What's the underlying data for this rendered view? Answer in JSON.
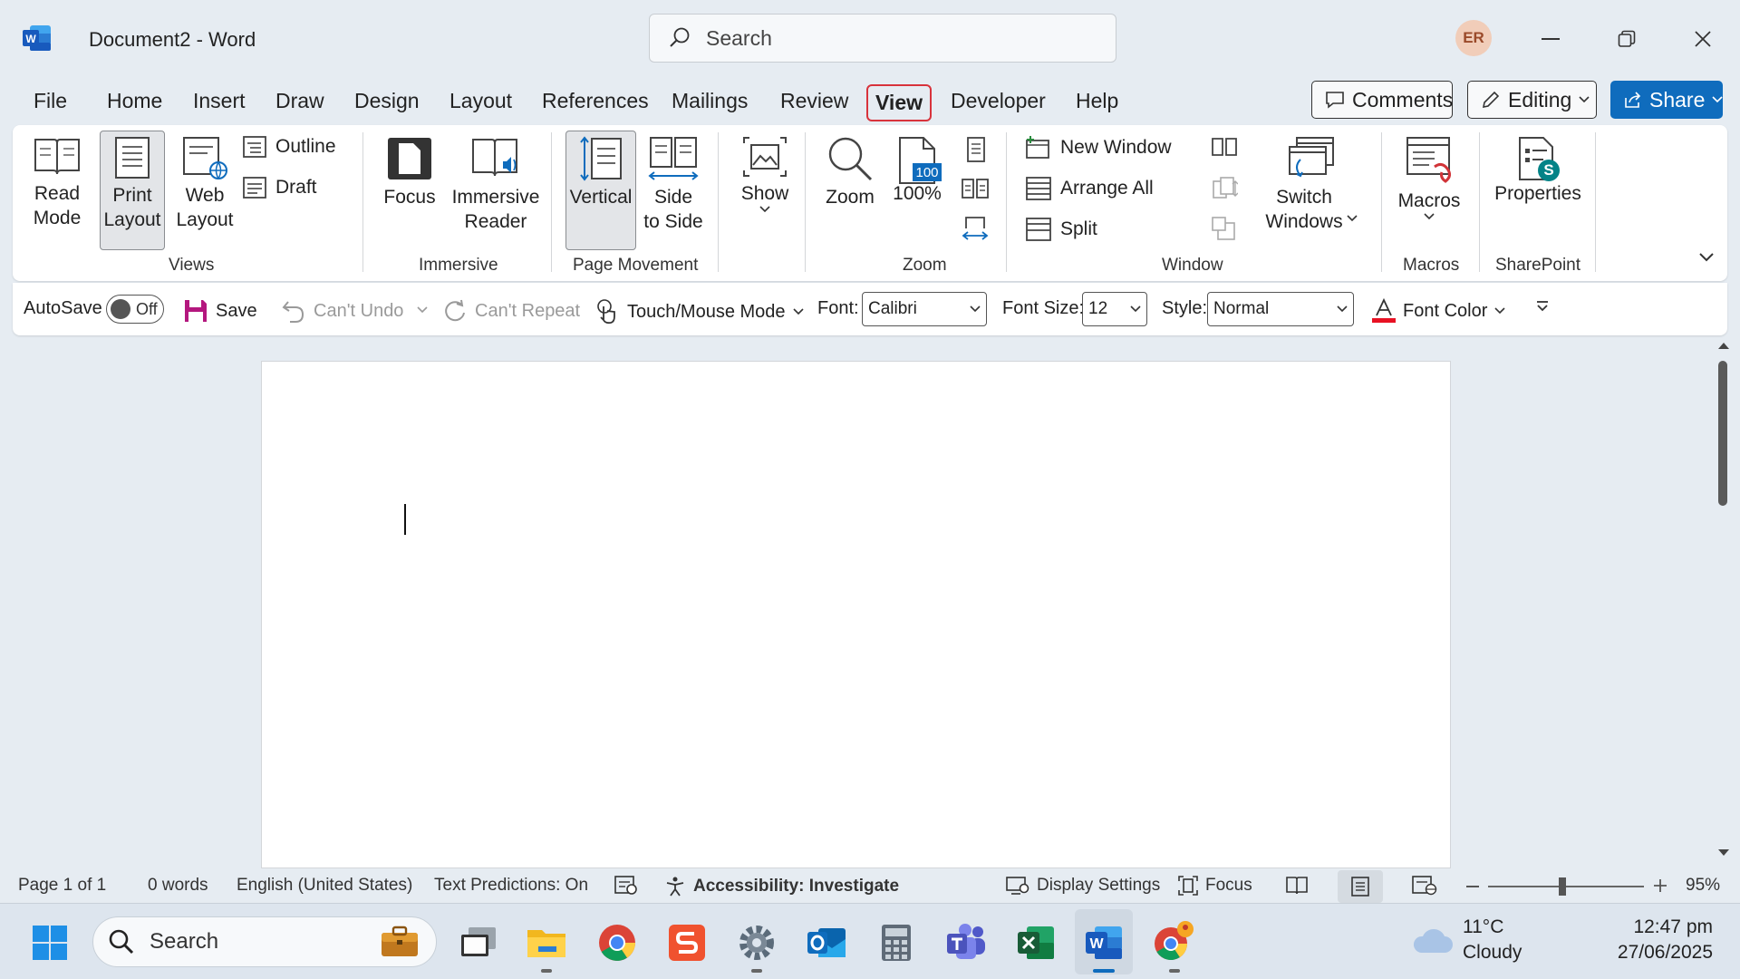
{
  "window": {
    "title": "Document2  -  Word",
    "search_placeholder": "Search",
    "user_initials": "ER"
  },
  "tabs": [
    "File",
    "Home",
    "Insert",
    "Draw",
    "Design",
    "Layout",
    "References",
    "Mailings",
    "Review",
    "View",
    "Developer",
    "Help"
  ],
  "active_tab": "View",
  "header_buttons": {
    "comments": "Comments",
    "editing": "Editing",
    "share": "Share"
  },
  "ribbon": {
    "views": {
      "read_mode": "Read\nMode",
      "print_layout": "Print\nLayout",
      "web_layout": "Web\nLayout",
      "outline": "Outline",
      "draft": "Draft",
      "group": "Views"
    },
    "immersive": {
      "focus": "Focus",
      "immersive_reader": "Immersive\nReader",
      "group": "Immersive"
    },
    "page_movement": {
      "vertical": "Vertical",
      "side_to_side": "Side\nto Side",
      "group": "Page Movement"
    },
    "show": {
      "label": "Show"
    },
    "zoom": {
      "zoom": "Zoom",
      "hundred": "100%",
      "badge": "100",
      "group": "Zoom"
    },
    "window": {
      "new_window": "New Window",
      "arrange_all": "Arrange All",
      "split": "Split",
      "switch_windows": "Switch\nWindows",
      "group": "Window"
    },
    "macros": {
      "label": "Macros",
      "group": "Macros"
    },
    "sharepoint": {
      "label": "Properties",
      "group": "SharePoint",
      "badge": "S"
    }
  },
  "qat": {
    "autosave": "AutoSave",
    "toggle": "Off",
    "save": "Save",
    "undo": "Can't Undo",
    "repeat": "Can't Repeat",
    "touch": "Touch/Mouse Mode",
    "font_label": "Font:",
    "font_value": "Calibri",
    "size_label": "Font Size:",
    "size_value": "12",
    "style_label": "Style:",
    "style_value": "Normal",
    "font_color": "Font Color"
  },
  "status": {
    "page": "Page 1 of 1",
    "words": "0 words",
    "language": "English (United States)",
    "predictions": "Text Predictions: On",
    "accessibility": "Accessibility: Investigate",
    "display_settings": "Display Settings",
    "focus": "Focus",
    "zoom": "95%"
  },
  "taskbar": {
    "search": "Search",
    "temp": "11°C",
    "weather": "Cloudy",
    "time": "12:47 pm",
    "date": "27/06/2025"
  },
  "colors": {
    "accent": "#0f6cbd",
    "tab_highlight": "#d8333c",
    "word_blue": "#185abd"
  }
}
